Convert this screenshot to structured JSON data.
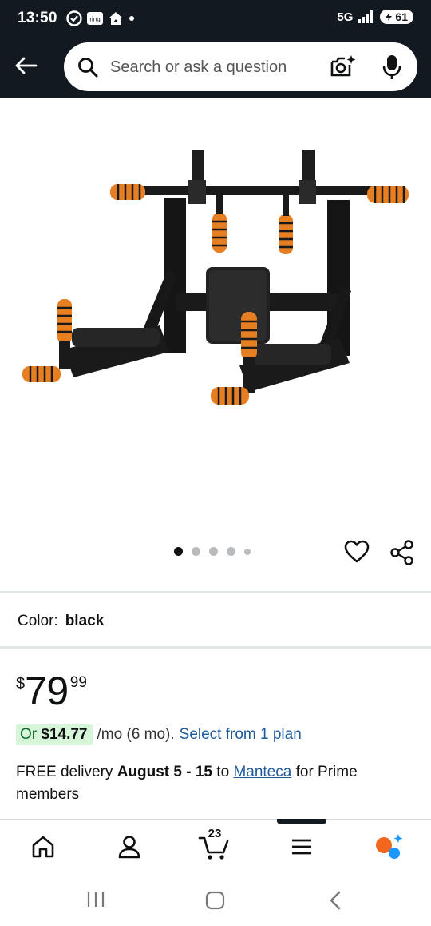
{
  "status_bar": {
    "time": "13:50",
    "network": "5G",
    "battery": "61",
    "icons": [
      "sync-icon",
      "ring-icon",
      "home-alert-icon",
      "dot-icon",
      "signal-icon",
      "battery-icon"
    ]
  },
  "search": {
    "placeholder": "Search or ask a question"
  },
  "carousel": {
    "count": 5,
    "active_index": 0
  },
  "product": {
    "color_label": "Color:",
    "color_value": "black",
    "price_symbol": "$",
    "price_whole": "79",
    "price_fraction": "99"
  },
  "installment": {
    "or": "Or",
    "amount": "$14.77",
    "term": "/mo (6 mo).",
    "link": "Select from 1 plan"
  },
  "delivery": {
    "prefix": "FREE delivery",
    "dates": "August 5 - 15",
    "to": "to",
    "location": "Manteca",
    "suffix": "for Prime members"
  },
  "bottom_nav": {
    "cart_count": "23",
    "items": [
      "home-icon",
      "account-icon",
      "cart-icon",
      "menu-icon",
      "rufus-icon"
    ]
  },
  "colors": {
    "header_bg": "#131921",
    "link": "#1d5a9a",
    "badge_bg": "#d7f5d9",
    "foam_orange": "#f28c28"
  }
}
